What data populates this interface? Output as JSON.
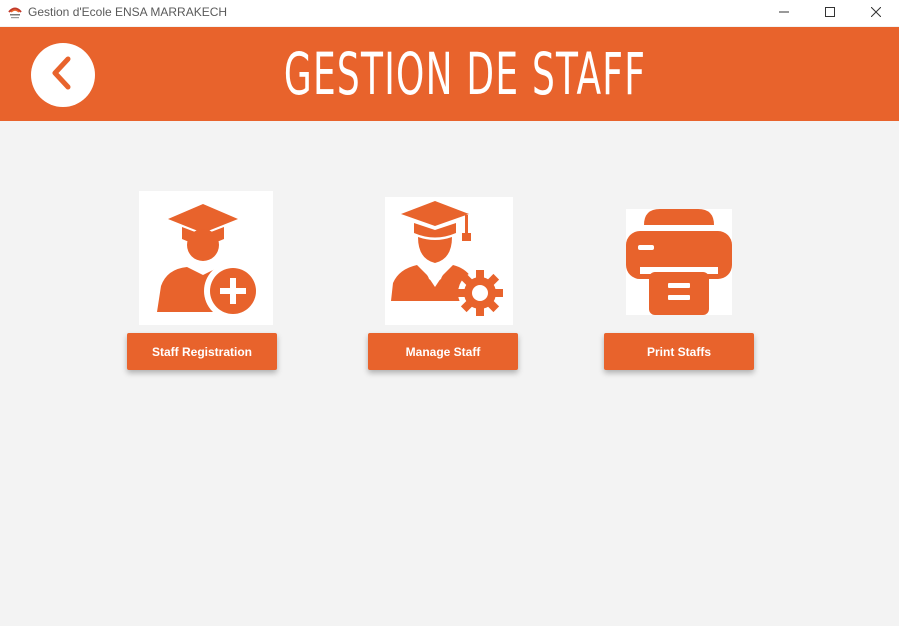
{
  "window": {
    "title": "Gestion d'Ecole ENSA MARRAKECH",
    "controls": [
      "minimize-icon",
      "maximize-icon",
      "close-icon"
    ]
  },
  "header": {
    "title": "GESTION DE STAFF",
    "back_icon": "chevron-left-icon"
  },
  "actions": [
    {
      "label": "Staff Registration",
      "icon": "staff-add-icon"
    },
    {
      "label": "Manage Staff",
      "icon": "staff-settings-icon"
    },
    {
      "label": "Print Staffs",
      "icon": "printer-icon"
    }
  ],
  "colors": {
    "accent": "#e8632c",
    "background": "#f3f3f3",
    "titlebar": "#ffffff"
  }
}
